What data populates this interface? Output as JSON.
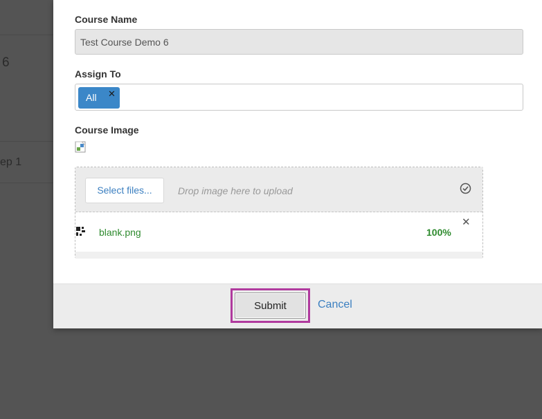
{
  "background": {
    "text_1": "6",
    "text_2": "ep 1"
  },
  "form": {
    "course_name_label": "Course Name",
    "course_name_value": "Test Course Demo 6",
    "assign_to_label": "Assign To",
    "assign_to_tags": [
      {
        "label": "All",
        "remove_glyph": "✕"
      }
    ],
    "course_image_label": "Course Image"
  },
  "upload": {
    "select_files_label": "Select files...",
    "drop_hint": "Drop image here to upload",
    "files": [
      {
        "name": "blank.png",
        "progress": "100%",
        "remove_glyph": "✕"
      }
    ]
  },
  "footer": {
    "submit_label": "Submit",
    "cancel_label": "Cancel"
  },
  "colors": {
    "accent_blue": "#3b87c8",
    "success_green": "#2e8a2e",
    "highlight": "#b03a9e"
  },
  "icons": {
    "broken_image": "broken-image-icon",
    "upload_ok": "check-circle-icon",
    "file": "file-icon",
    "remove": "close-icon"
  }
}
